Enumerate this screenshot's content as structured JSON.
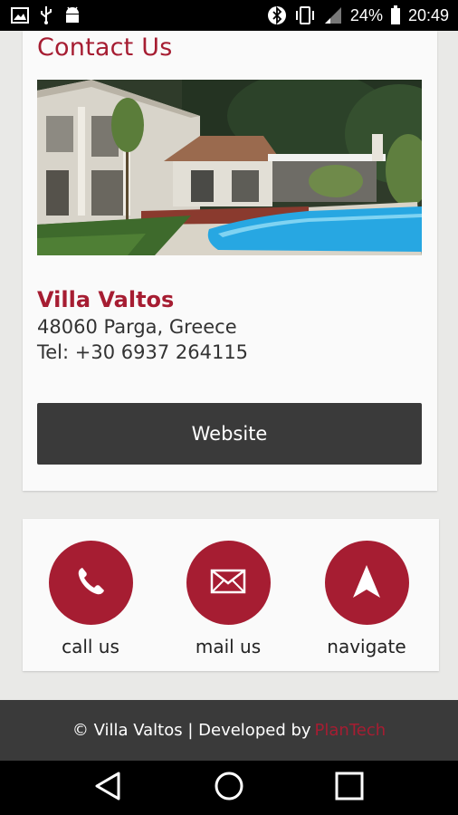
{
  "status_bar": {
    "battery": "24%",
    "time": "20:49",
    "icons": [
      "image-icon",
      "usb-icon",
      "android-icon",
      "bluetooth-icon",
      "vibrate-icon",
      "signal-icon",
      "battery-icon"
    ]
  },
  "contact": {
    "title": "Contact Us",
    "name": "Villa Valtos",
    "address": "48060 Parga, Greece",
    "phone": "Tel: +30 6937 264115",
    "website_button": "Website"
  },
  "actions": [
    {
      "label": "call us",
      "icon": "phone-icon"
    },
    {
      "label": "mail us",
      "icon": "mail-icon"
    },
    {
      "label": "navigate",
      "icon": "navigate-icon"
    }
  ],
  "footer": {
    "text": "© Villa Valtos | Developed by",
    "brand": "PlanTech"
  },
  "colors": {
    "accent": "#a61d32",
    "dark": "#3a3a3a",
    "background": "#e9e9e7"
  },
  "nav_icons": [
    "back-icon",
    "home-icon",
    "recents-icon"
  ]
}
